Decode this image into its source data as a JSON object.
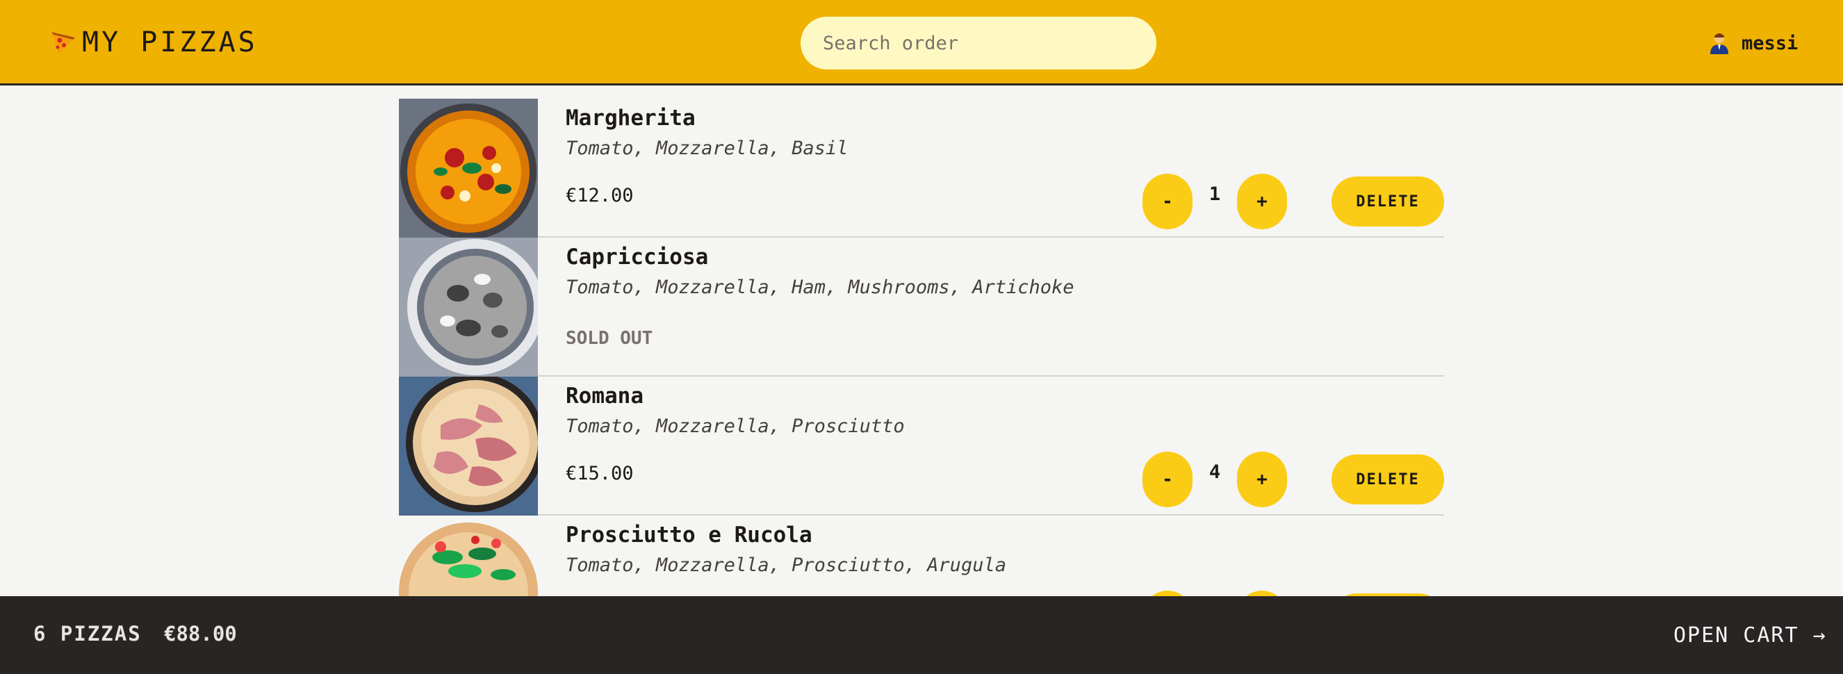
{
  "header": {
    "logo_text": "MY PIZZAS",
    "search_placeholder": "Search order",
    "username": "messi"
  },
  "cart_items": [
    {
      "name": "Margherita",
      "ingredients": "Tomato, Mozzarella, Basil",
      "price": "€12.00",
      "quantity": "1",
      "sold_out": false,
      "minus_label": "-",
      "plus_label": "+",
      "delete_label": "DELETE",
      "image_icon": "pizza-margherita-image"
    },
    {
      "name": "Capricciosa",
      "ingredients": "Tomato, Mozzarella, Ham, Mushrooms, Artichoke",
      "status": "Sold out",
      "sold_out": true,
      "image_icon": "pizza-capricciosa-image"
    },
    {
      "name": "Romana",
      "ingredients": "Tomato, Mozzarella, Prosciutto",
      "price": "€15.00",
      "quantity": "4",
      "sold_out": false,
      "minus_label": "-",
      "plus_label": "+",
      "delete_label": "DELETE",
      "image_icon": "pizza-romana-image"
    },
    {
      "name": "Prosciutto e Rucola",
      "ingredients": "Tomato, Mozzarella, Prosciutto, Arugula",
      "sold_out": false,
      "image_icon": "pizza-prosciutto-rucola-image"
    }
  ],
  "footer": {
    "pizza_count": "6 PIZZAS",
    "total": "€88.00",
    "open_cart_label": "OPEN CART →"
  },
  "colors": {
    "header_bg": "#f0b200",
    "accent_button": "#facc15",
    "search_bg": "#fef9c3",
    "footer_bg": "#292524",
    "page_bg": "#f5f5f3"
  }
}
